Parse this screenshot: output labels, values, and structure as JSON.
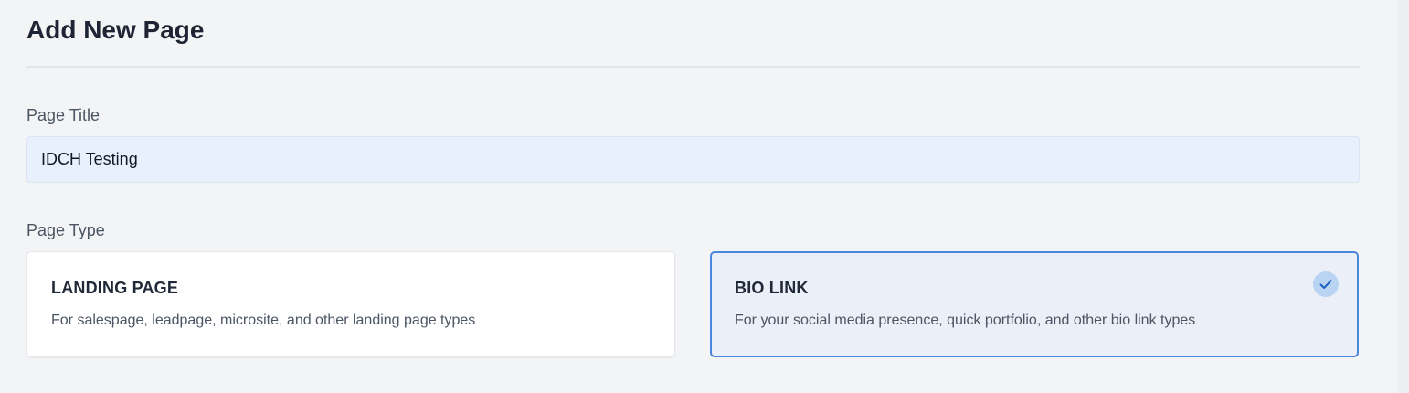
{
  "header": {
    "title": "Add New Page"
  },
  "form": {
    "page_title": {
      "label": "Page Title",
      "value": "IDCH Testing"
    },
    "page_type": {
      "label": "Page Type",
      "selected": "bio_link",
      "options": [
        {
          "id": "landing_page",
          "title": "LANDING PAGE",
          "description": "For salespage, leadpage, microsite, and other landing page types"
        },
        {
          "id": "bio_link",
          "title": "BIO LINK",
          "description": "For your social media presence, quick portfolio, and other bio link types"
        }
      ]
    }
  },
  "icons": {
    "selected_indicator": "check-icon"
  },
  "colors": {
    "accent": "#4a86dc",
    "selected_card_bg": "#ebf0f8",
    "input_bg": "#e8f0fe",
    "check_badge_bg": "#b9d3f3"
  }
}
